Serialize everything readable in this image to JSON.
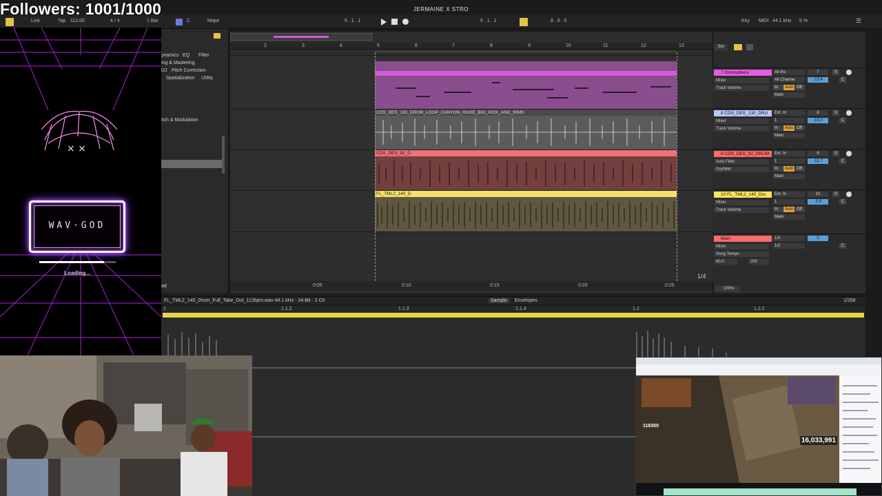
{
  "overlay": {
    "followers": "Followers: 1001/1000",
    "loading": "Loading...",
    "logo_text": "WAV·GOD",
    "loading_progress": 0.85
  },
  "daw": {
    "song_title": "JERMAINE X STRO",
    "topbar": {
      "link": "Link",
      "tap": "Tap",
      "tempo": "112.00",
      "time_sig": "4 / 4",
      "quant": "1 Bar",
      "key": "C",
      "scale": "Major",
      "position": "5 . 1 . 1",
      "loop_start": "5 . 1 . 1",
      "loop_len": "8 . 0 . 0",
      "key_btn": "Key",
      "midi_btn": "MIDI",
      "sample_rate": "44.1 kHz",
      "cpu": "6 %"
    },
    "browser": {
      "items": [
        "ynamics",
        "EQ",
        "Filter",
        "ing & Mastering",
        "DJ",
        "Pitch Correction",
        "Spatialization",
        "Utility",
        "itch & Modulation"
      ],
      "bottom_label": "ad"
    },
    "arrangement": {
      "bar_numbers": [
        "2",
        "3",
        "4",
        "5",
        "6",
        "7",
        "8",
        "9",
        "10",
        "11",
        "12",
        "13"
      ],
      "time_labels": [
        "0:05",
        "0:10",
        "0:15",
        "0:20",
        "0:25"
      ],
      "page_indicator": "1/4",
      "clips": [
        {
          "name": "",
          "color": "#d45adb"
        },
        {
          "name": "CDS_DES_130_DRUM_LOOP_CANYON_HUGE_BIG_KICK_AND_RIMS",
          "color": "#8a8a8a"
        },
        {
          "name": "CDS_DES_92_D",
          "color": "#f07177"
        },
        {
          "name": "FL_TML2_140_D",
          "color": "#f3e26a"
        }
      ]
    },
    "tracks": [
      {
        "name": "7 Omnisphere",
        "color": "#e65be6",
        "device": "Mixer",
        "param": "Track Volume",
        "route": "Main",
        "input": "All Ins",
        "channel": "All Channe",
        "volume": "-13.4",
        "number": "7"
      },
      {
        "name": "8 CDS_DES_130_DRU",
        "color": "#b9c7ff",
        "device": "Mixer",
        "param": "Track Volume",
        "route": "Main",
        "input": "Ext. In",
        "channel": "1",
        "volume": "-15.0",
        "number": "8"
      },
      {
        "name": "9 CDS_DES_92_DRUM",
        "color": "#ff6b6b",
        "device": "Auto Filter",
        "param": "Dry/Wet",
        "route": "Main",
        "input": "Ext. In",
        "channel": "1",
        "volume": "-12.7",
        "number": "9"
      },
      {
        "name": "10 FL_TML2_140_Dru",
        "color": "#ffe45a",
        "device": "Mixer",
        "param": "Track Volume",
        "route": "Main",
        "input": "Ext. In",
        "channel": "1",
        "volume": "-5.9",
        "number": "10"
      }
    ],
    "main_track": {
      "name": "Main",
      "color": "#ff6b6b",
      "device": "Mixer",
      "param": "Song Tempo",
      "range_min": "60.0",
      "range_max": "200",
      "io_a": "1/2",
      "io_b": "1/2",
      "volume": "0",
      "zoom": "100%"
    },
    "labels": {
      "auto": "Auto",
      "off": "Off",
      "in": "In",
      "s": "S",
      "c": "C",
      "set": "Set"
    },
    "detail": {
      "file_info": "FL_TML2_140_Drum_Full_Take_Out_112bpm.wav  44.1 kHz · 24-Bit · 2 Ch",
      "tab_sample": "Sample",
      "tab_envelopes": "Envelopes",
      "zoom": "1/256",
      "ruler": [
        "1",
        "1.1.2",
        "1.1.3",
        "1.1.4",
        "1.2",
        "1.2.2"
      ]
    }
  },
  "stream": {
    "viewers": "16,033,991",
    "donation": "119350"
  },
  "colors": {
    "neon_pink": "#ff5fd0",
    "neon_purple": "#b55cff",
    "clip_yellow": "#f3e26a"
  }
}
